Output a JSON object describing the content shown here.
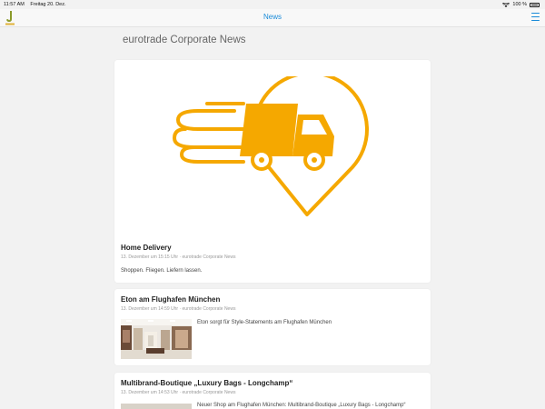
{
  "status": {
    "time": "11:57 AM",
    "date": "Freitag 20. Dez.",
    "battery": "100 %"
  },
  "nav": {
    "title": "News"
  },
  "colors": {
    "accent": "#1a8bd9",
    "hero_icon": "#f5a800"
  },
  "page": {
    "heading": "eurotrade Corporate News"
  },
  "articles": [
    {
      "title": "Home Delivery",
      "meta": "13. Dezember um 15:15 Uhr · eurotrade Corporate News",
      "description": "Shoppen. Fliegen. Liefern lassen.",
      "image_icon": "delivery-truck-location-icon"
    },
    {
      "title": "Eton am Flughafen München",
      "meta": "13. Dezember um 14:59 Uhr · eurotrade Corporate News",
      "description": "Eton sorgt für Style-Statements am Flughafen München"
    },
    {
      "title": "Multibrand-Boutique „Luxury Bags - Longchamp“",
      "meta": "13. Dezember um 14:53 Uhr · eurotrade Corporate News",
      "description": "Neuer Shop am Flughafen München: Multibrand-Boutique „Luxury Bags - Longchamp“"
    }
  ]
}
